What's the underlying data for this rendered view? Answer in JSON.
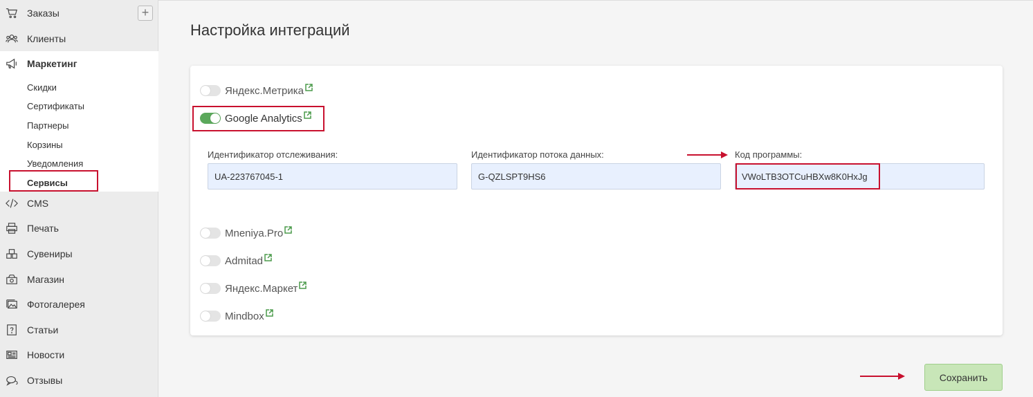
{
  "sidebar": {
    "items": [
      {
        "label": "Заказы",
        "icon": "cart-icon"
      },
      {
        "label": "Клиенты",
        "icon": "users-icon"
      },
      {
        "label": "Маркетинг",
        "icon": "megaphone-icon"
      },
      {
        "label": "CMS",
        "icon": "code-icon"
      },
      {
        "label": "Печать",
        "icon": "printer-icon"
      },
      {
        "label": "Сувениры",
        "icon": "boxes-icon"
      },
      {
        "label": "Магазин",
        "icon": "shop-icon"
      },
      {
        "label": "Фотогалерея",
        "icon": "gallery-icon"
      },
      {
        "label": "Статьи",
        "icon": "question-icon"
      },
      {
        "label": "Новости",
        "icon": "newspaper-icon"
      },
      {
        "label": "Отзывы",
        "icon": "chat-icon"
      }
    ],
    "plus_label": "+",
    "marketing_sub": [
      "Скидки",
      "Сертификаты",
      "Партнеры",
      "Корзины",
      "Уведомления",
      "Сервисы"
    ]
  },
  "main": {
    "title": "Настройка интеграций",
    "integrations": [
      {
        "label": "Яндекс.Метрика",
        "enabled": false
      },
      {
        "label": "Google Analytics",
        "enabled": true
      },
      {
        "label": "Mneniya.Pro",
        "enabled": false
      },
      {
        "label": "Admitad",
        "enabled": false
      },
      {
        "label": "Яндекс.Маркет",
        "enabled": false
      },
      {
        "label": "Mindbox",
        "enabled": false
      }
    ],
    "fields": [
      {
        "label": "Идентификатор отслеживания:",
        "value": "UA-223767045-1"
      },
      {
        "label": "Идентификатор потока данных:",
        "value": "G-QZLSPT9HS6"
      },
      {
        "label": "Код программы:",
        "value": "VWoLTB3OTCuHBXw8K0HxJg"
      }
    ],
    "save_label": "Сохранить"
  },
  "colors": {
    "highlight": "#c8102e",
    "toggle_on": "#5ba85b",
    "save_button": "#c8e6b8",
    "input_bg": "#e8f0fe"
  }
}
